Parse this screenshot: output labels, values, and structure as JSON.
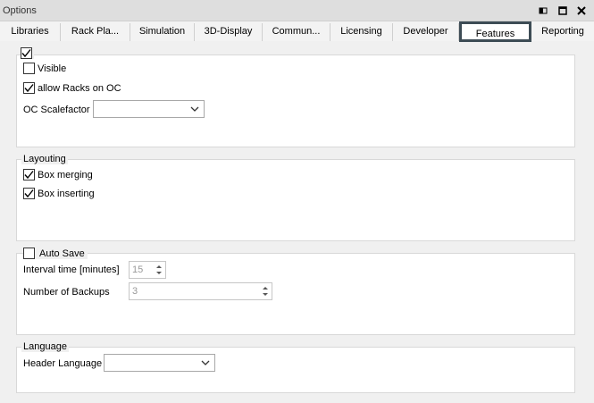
{
  "window": {
    "title": "Options"
  },
  "tabs": [
    {
      "label": "Libraries"
    },
    {
      "label": "Rack Pla..."
    },
    {
      "label": "Simulation"
    },
    {
      "label": "3D-Display"
    },
    {
      "label": "Commun..."
    },
    {
      "label": "Licensing"
    },
    {
      "label": "Developer"
    },
    {
      "label": "Features",
      "active": true
    },
    {
      "label": "Reporting"
    }
  ],
  "oc_group": {
    "enabled_checked": true,
    "visible": {
      "label": "Visible",
      "checked": false
    },
    "allow_racks": {
      "label": "allow Racks on OC",
      "checked": true
    },
    "scalefactor": {
      "label": "OC Scalefactor",
      "value": ""
    }
  },
  "layouting": {
    "title": "Layouting",
    "box_merging": {
      "label": "Box merging",
      "checked": true
    },
    "box_inserting": {
      "label": "Box inserting",
      "checked": true
    }
  },
  "autosave": {
    "title": "Auto Save",
    "checked": false,
    "interval": {
      "label": "Interval time [minutes]",
      "value": "15"
    },
    "backups": {
      "label": "Number of Backups",
      "value": "3"
    }
  },
  "language": {
    "title": "Language",
    "header_language": {
      "label": "Header Language",
      "value": ""
    }
  },
  "colors": {
    "active_tab_border": "#3d4c55",
    "group_border": "#d8d8d8",
    "disabled_text": "#999999"
  }
}
